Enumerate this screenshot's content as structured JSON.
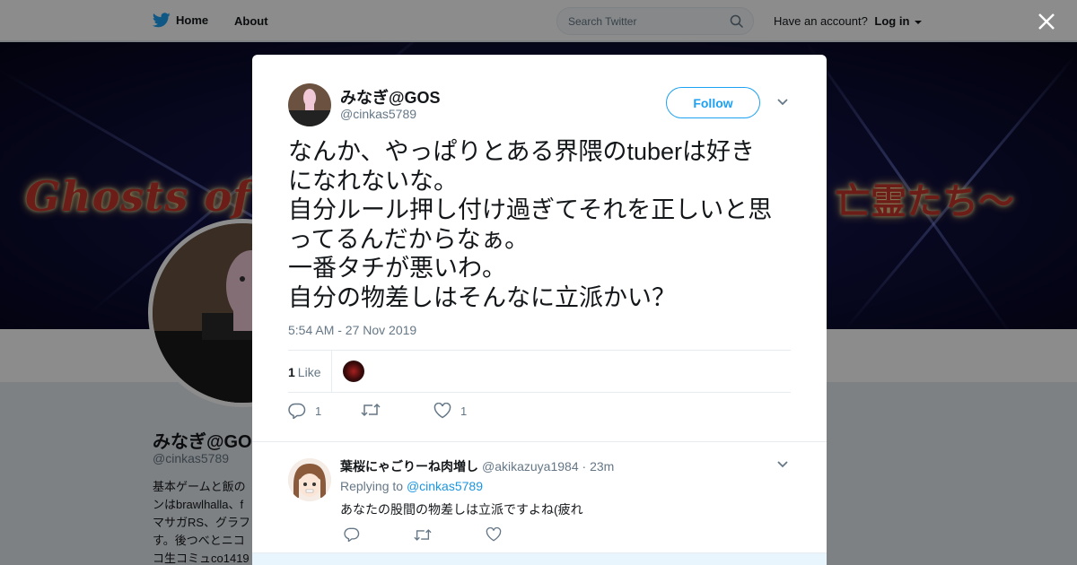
{
  "nav": {
    "home_label": "Home",
    "about_label": "About",
    "search_placeholder": "Search Twitter",
    "account_prompt": "Have an account?",
    "login_label": "Log in"
  },
  "banner": {
    "title_left": "Ghosts of h",
    "title_right": "亡霊たち〜"
  },
  "profile": {
    "name": "みなぎ@GOS",
    "handle": "@cinkas5789",
    "bio": "基本ゲームと飯の\nンはbrawlhalla、f\nマサガRS、グラフ\nす。後つべとニコ\nコ生コミュco1419"
  },
  "tweet": {
    "author_name": "みなぎ@GOS",
    "author_handle": "@cinkas5789",
    "follow_label": "Follow",
    "text": "なんか、やっぱりとある界隈のtuberは好き\nになれないな。\n自分ルール押し付け過ぎてそれを正しいと思\nってるんだからなぁ。\n一番タチが悪いわ。\n自分の物差しはそんなに立派かい？",
    "timestamp": "5:54 AM - 27 Nov 2019",
    "like_count": "1",
    "like_label": "Like",
    "reply_count": "1",
    "like_action_count": "1"
  },
  "reply": {
    "author_name": "葉桜にゃごりーね肉増し",
    "author_handle": "@akikazuya1984",
    "time": "· 23m",
    "replying_prefix": "Replying to",
    "replying_to": "@cinkas5789",
    "text": "あなたの股間の物差しは立派ですよね(疲れ"
  },
  "colors": {
    "accent": "#1da1f2",
    "text": "#14171a",
    "muted": "#657786"
  }
}
